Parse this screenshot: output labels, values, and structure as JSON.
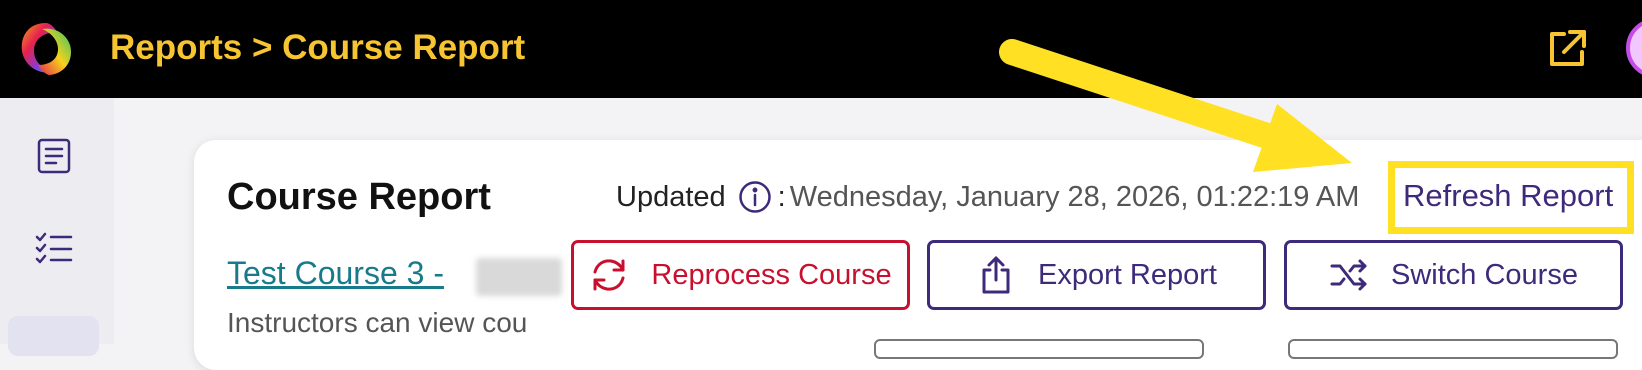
{
  "header": {
    "breadcrumb": "Reports > Course Report"
  },
  "report": {
    "title": "Course Report",
    "updated_label": "Updated",
    "updated_value": "Wednesday, January 28, 2026, 01:22:19 AM",
    "refresh_label": "Refresh Report",
    "course_link": "Test Course 3 -",
    "description": "Instructors can view cou"
  },
  "actions": {
    "reprocess_label": "Reprocess Course",
    "export_label": "Export Report",
    "switch_label": "Switch Course"
  },
  "colors": {
    "accent_yellow": "#f7c531",
    "primary_purple": "#3e2a7a",
    "danger_red": "#c8102e",
    "link_teal": "#177b8a",
    "highlight_yellow": "#ffe022"
  }
}
